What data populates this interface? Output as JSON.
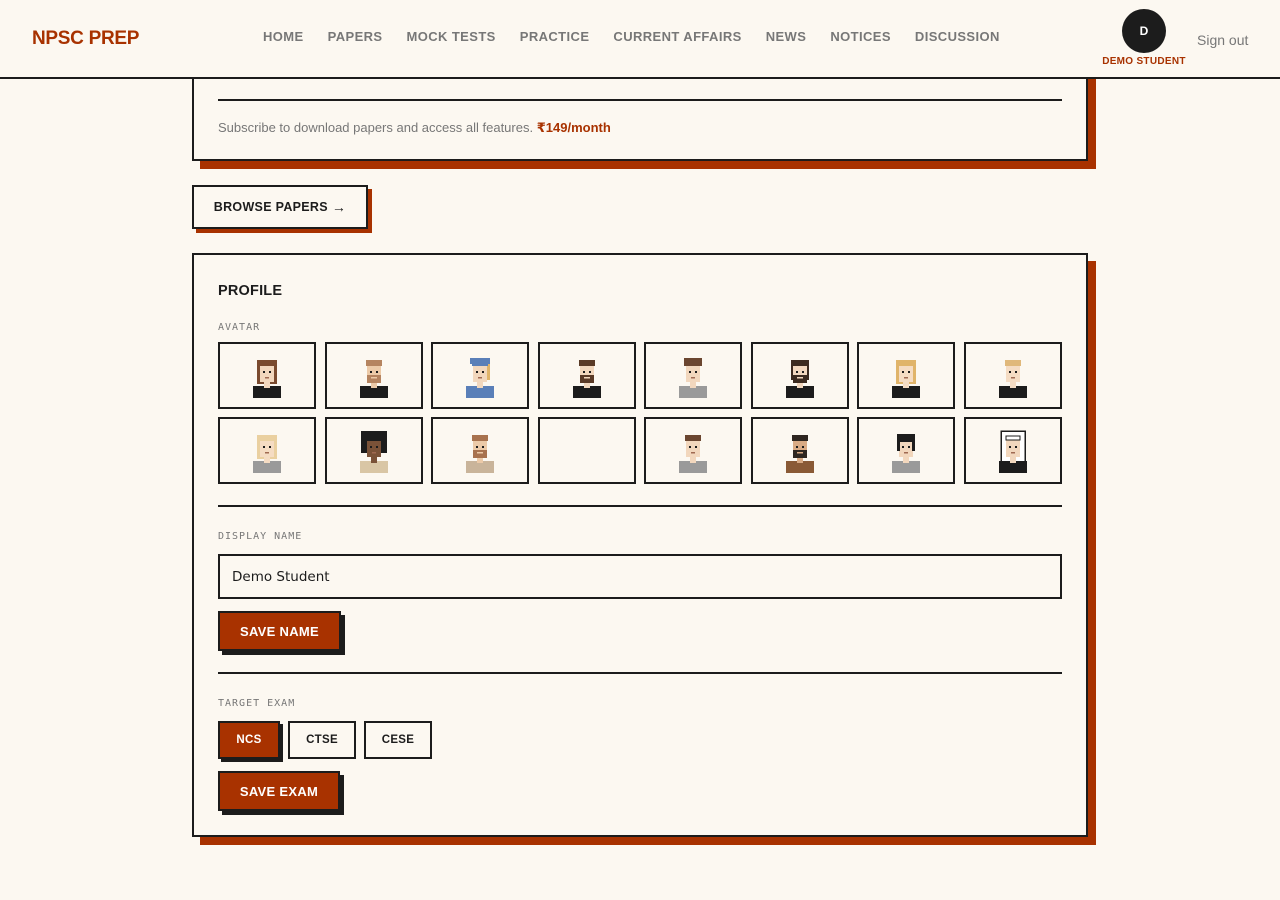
{
  "brand": "NPSC PREP",
  "nav": [
    "HOME",
    "PAPERS",
    "MOCK TESTS",
    "PRACTICE",
    "CURRENT AFFAIRS",
    "NEWS",
    "NOTICES",
    "DISCUSSION"
  ],
  "user": {
    "initial": "D",
    "name": "DEMO STUDENT",
    "signout": "Sign out"
  },
  "subscription": {
    "text": "Subscribe to download papers and access all features.",
    "price": "₹149/month"
  },
  "browse_button": "BROWSE PAPERS",
  "browse_arrow": "→",
  "profile": {
    "title": "PROFILE",
    "avatar_label": "AVATAR",
    "avatars": [
      {
        "hair": "#7a4a2e",
        "skin": "#f2d7bd",
        "shirt": "#1c1c1c",
        "style": "long"
      },
      {
        "hair": "#b58460",
        "skin": "#eccaa8",
        "shirt": "#1c1c1c",
        "style": "beard"
      },
      {
        "hair": "#5a7fb8",
        "skin": "#f2d7bd",
        "shirt": "#5a7fb8",
        "style": "scarf"
      },
      {
        "hair": "#5a3a26",
        "skin": "#f2d7bd",
        "shirt": "#1c1c1c",
        "style": "beard"
      },
      {
        "hair": "#6b4630",
        "skin": "#f2d7bd",
        "shirt": "#9a9a9a",
        "style": "curly"
      },
      {
        "hair": "#3c2a1e",
        "skin": "#f2d7bd",
        "shirt": "#1c1c1c",
        "style": "longbeard"
      },
      {
        "hair": "#e0b46a",
        "skin": "#f5dcc3",
        "shirt": "#1c1c1c",
        "style": "long"
      },
      {
        "hair": "#e0b87a",
        "skin": "#f5dcc3",
        "shirt": "#1c1c1c",
        "style": "short"
      },
      {
        "hair": "#ead0a0",
        "skin": "#f5dcc3",
        "shirt": "#9a9a9a",
        "style": "long"
      },
      {
        "hair": "#1c1c1c",
        "skin": "#7a5238",
        "shirt": "#d9c6a5",
        "style": "afro"
      },
      {
        "hair": "#a8724e",
        "skin": "#eccaa8",
        "shirt": "#c9b49a",
        "style": "beard"
      },
      {
        "hair": "",
        "skin": "",
        "shirt": "",
        "style": "empty"
      },
      {
        "hair": "#6b4630",
        "skin": "#f2d7bd",
        "shirt": "#9a9a9a",
        "style": "short"
      },
      {
        "hair": "#2e2620",
        "skin": "#d8aa84",
        "shirt": "#8a5a36",
        "style": "beard"
      },
      {
        "hair": "#1c1c1c",
        "skin": "#f2d7bd",
        "shirt": "#9a9a9a",
        "style": "bob"
      },
      {
        "hair": "#ffffff",
        "skin": "#f2d7bd",
        "shirt": "#1c1c1c",
        "style": "hood"
      }
    ],
    "display_name_label": "DISPLAY NAME",
    "display_name_value": "Demo Student",
    "save_name": "SAVE NAME",
    "target_exam_label": "TARGET EXAM",
    "exams": [
      {
        "label": "NCS",
        "selected": true
      },
      {
        "label": "CTSE",
        "selected": false
      },
      {
        "label": "CESE",
        "selected": false
      }
    ],
    "save_exam": "SAVE EXAM"
  },
  "colors": {
    "accent": "#a83200",
    "ink": "#1c1c1c",
    "background": "#fcf8f1",
    "muted": "#777777"
  }
}
